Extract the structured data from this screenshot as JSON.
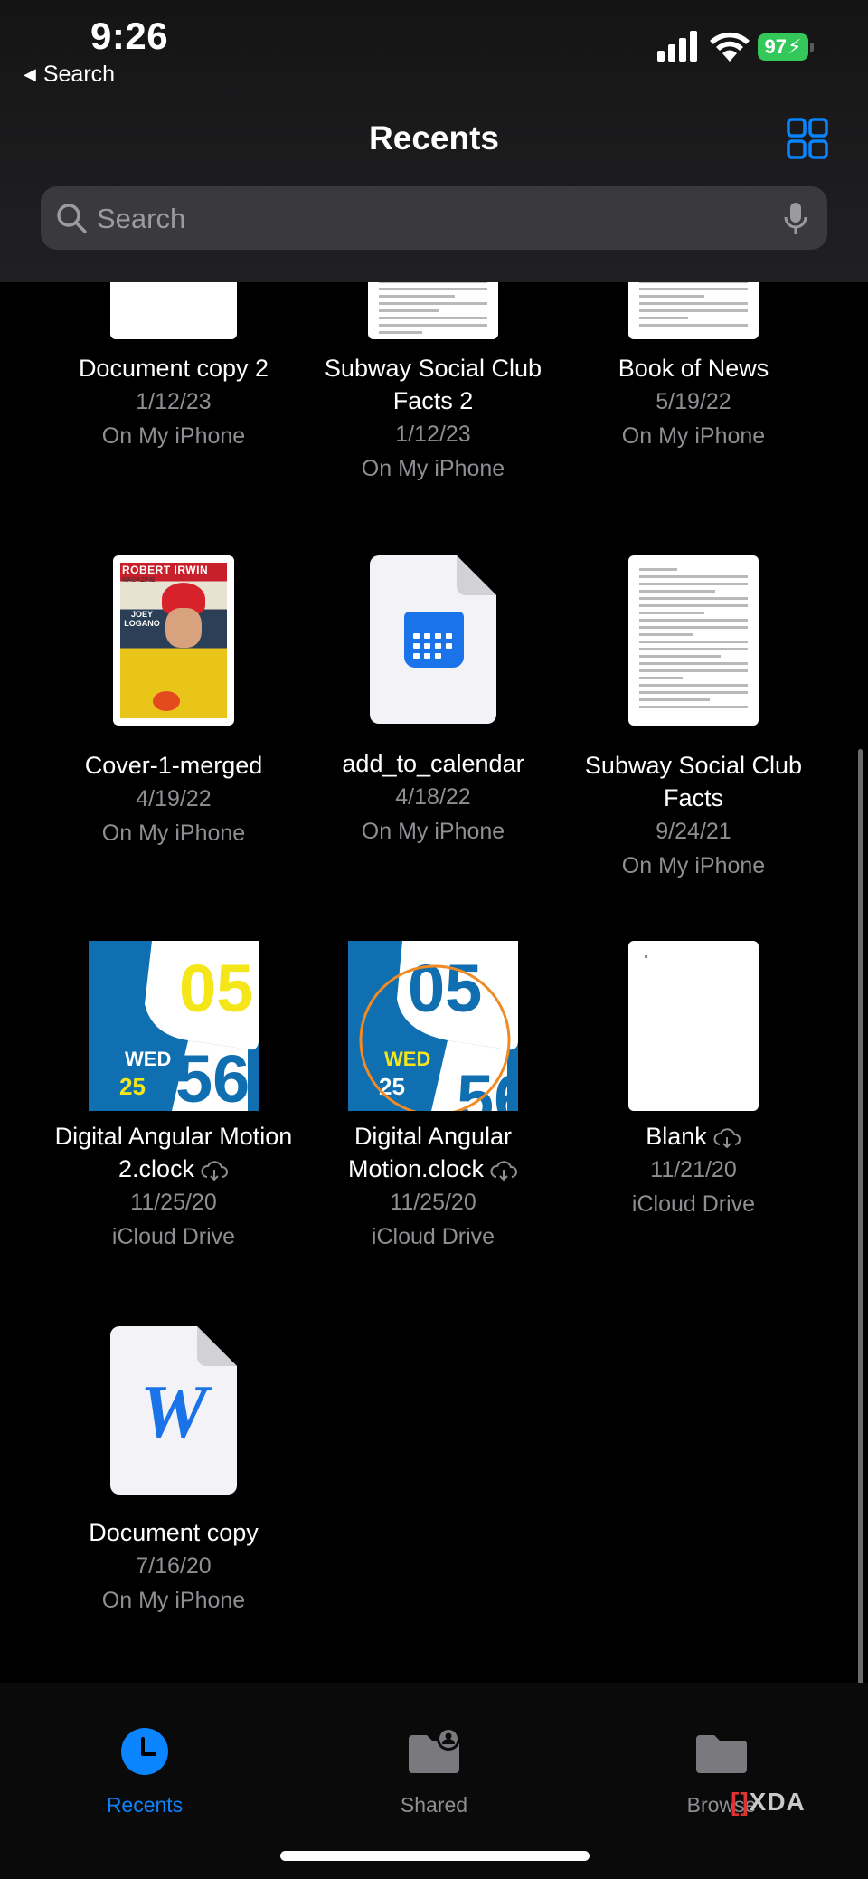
{
  "status_bar": {
    "time": "9:26",
    "back_label": "Search",
    "battery": "97"
  },
  "nav": {
    "title": "Recents"
  },
  "search": {
    "placeholder": "Search"
  },
  "items": [
    {
      "name": "Document copy 2",
      "date": "1/12/23",
      "location": "On My iPhone"
    },
    {
      "name": "Subway Social Club Facts 2",
      "date": "1/12/23",
      "location": "On My iPhone"
    },
    {
      "name": "Book of News",
      "date": "5/19/22",
      "location": "On My iPhone"
    },
    {
      "name": "Cover-1-merged",
      "date": "4/19/22",
      "location": "On My iPhone"
    },
    {
      "name": "add_to_calendar",
      "date": "4/18/22",
      "location": "On My iPhone"
    },
    {
      "name": "Subway Social Club Facts",
      "date": "9/24/21",
      "location": "On My iPhone"
    },
    {
      "name": "Digital Angular Motion 2.clock",
      "date": "11/25/20",
      "location": "iCloud Drive",
      "cloud": true
    },
    {
      "name": "Digital Angular Motion.clock",
      "date": "11/25/20",
      "location": "iCloud Drive",
      "cloud": true
    },
    {
      "name": "Blank",
      "date": "11/21/20",
      "location": "iCloud Drive",
      "cloud": true
    },
    {
      "name": "Document copy",
      "date": "7/16/20",
      "location": "On My iPhone"
    }
  ],
  "thumbnails": {
    "cover_title": "ROBERT IRWIN",
    "cover_sub": "MAGAZINE",
    "cover_name": "JOEY LOGANO",
    "clock_hour": "05",
    "clock_min": "56",
    "clock_day": "WED",
    "clock_date": "25",
    "word_letter": "W"
  },
  "tabs": [
    {
      "label": "Recents",
      "active": true
    },
    {
      "label": "Shared",
      "active": false
    },
    {
      "label": "Browse",
      "active": false
    }
  ],
  "watermark": {
    "prefix": "[]",
    "text": "XDA"
  },
  "colors": {
    "accent": "#0a84ff",
    "battery": "#34c759",
    "secondary_text": "#8e8e93",
    "clock_blue": "#0f6fb0",
    "clock_yellow": "#f5e61a"
  }
}
